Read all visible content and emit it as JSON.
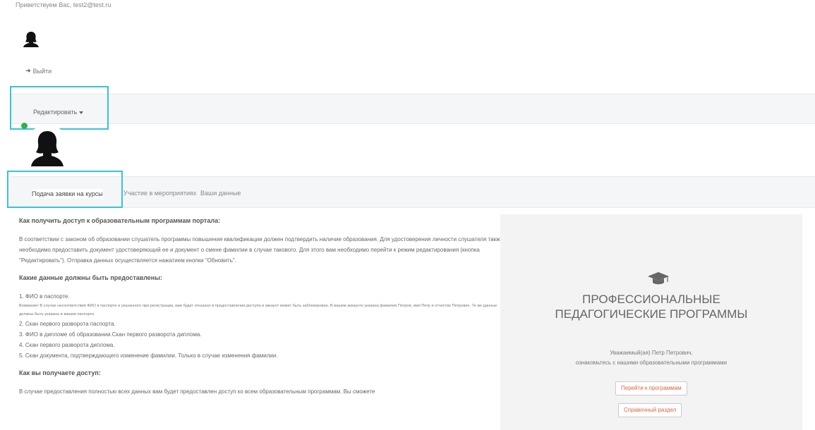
{
  "header": {
    "greeting": "Приветствуем Вас, test2@test.ru",
    "logout_label": "Выйти"
  },
  "nav": {
    "edit_label": "Редактировать"
  },
  "tabs": [
    {
      "label": "Подача заявки на курсы",
      "active": true
    },
    {
      "label": "Участие в мероприятиях",
      "active": false
    },
    {
      "label": "Ваши данные",
      "active": false
    }
  ],
  "content": {
    "h1": "Как получить доступ к образовательным программам портала:",
    "intro": "В соответствии с законом об образовании слушатель программы повышения квалификации должен подтвердить наличие образования. Для удостоверения личности слушателя также необходимо предоставить документ удостоверяющий ее и документ о смене фамилии в случае такового. Для этого вам необходимо перейти к режим редактирования (кнопка \"Редактировать\"). Отправка данных осуществляется нажатием кнопки \"Обновить\".",
    "h2": "Какие данные должны быть предоставлены:",
    "item1": "1. ФИО в паспорте.",
    "warning": "Внимание! В случае несоответствия ФИО в паспорте и указанного при регистрации, вам будет отказано в предоставлении доступа и аккаунт может быть заблокирован. В вашем аккаунте указана фамилия Петров, имя Петр и отчество Петрович. Те же данные должны быть указаны в вашем паспорте.",
    "item2": "2. Скан первого разворота паспорта.",
    "item3": "3. ФИО в дипломе об образовании.Скан первого разворота диплома.",
    "item4": "4. Скан первого разворота диплома.",
    "item5": "5. Скан документа, подтверждающего изменение фамилии. Только в случае изменения фамилии.",
    "h3": "Как вы получаете доступ:",
    "access_text": "В случае предоставления полностью всех данных вам будет предоставлен доступ ко всем образовательным программам. Вы сможете"
  },
  "panel": {
    "brand_line1": "ПРОФЕССИОНАЛЬНЫЕ",
    "brand_line2": "ПЕДАГОГИЧЕСКИЕ ПРОГРАММЫ",
    "welcome_line1": "Уважаемый(ая) Петр Петрович,",
    "welcome_line2": "ознакомьтесь с нашими образовательными программами",
    "btn_programs": "Перейти к программам",
    "btn_reference": "Справочный раздел"
  },
  "colors": {
    "accent_outline": "#37c3da",
    "online": "#2fb24a",
    "link_orange": "#e0633a"
  }
}
